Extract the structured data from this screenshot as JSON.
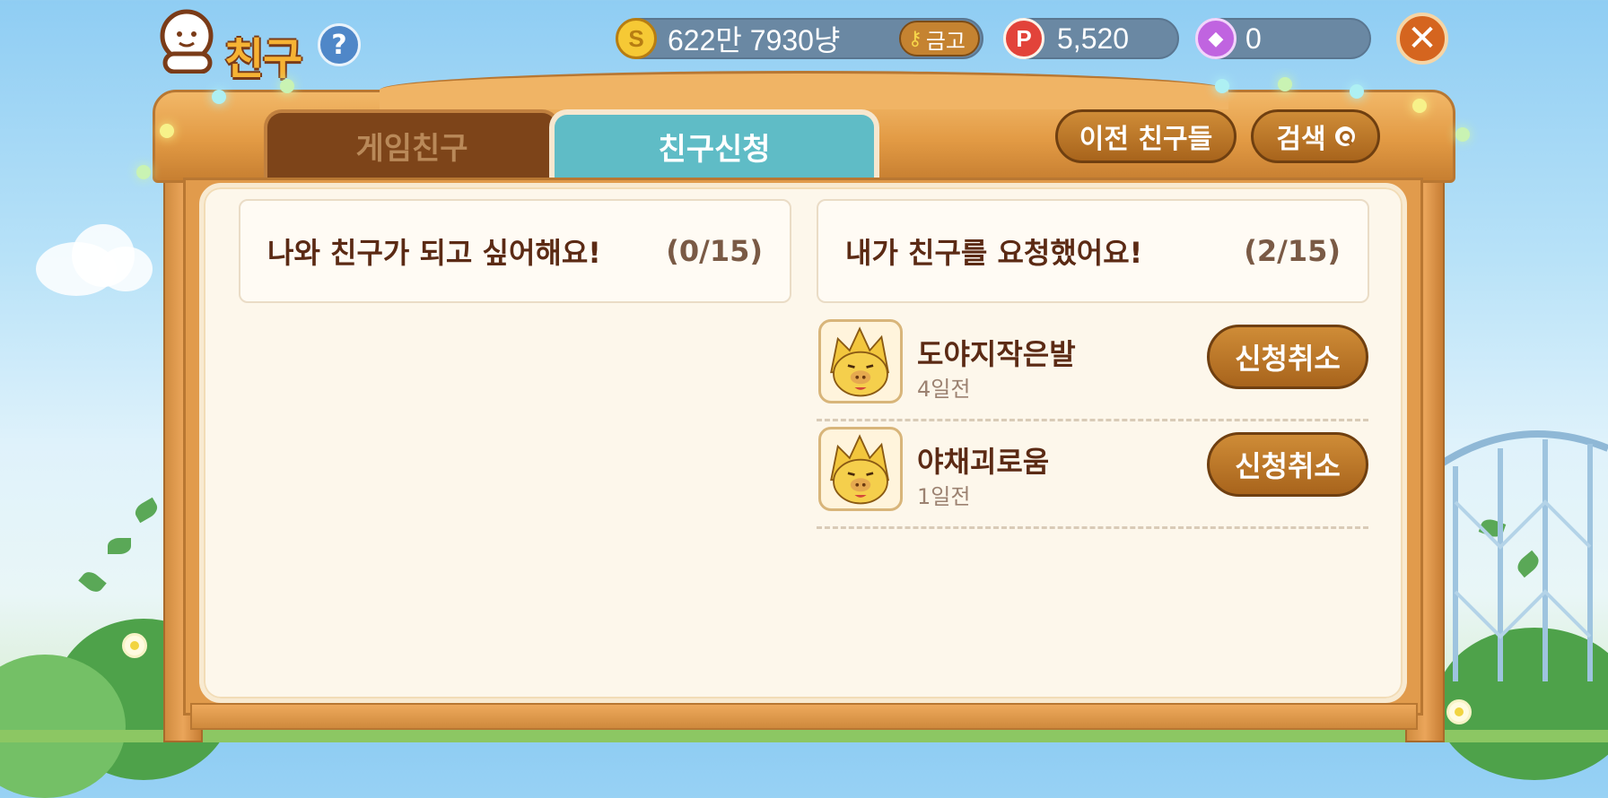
{
  "header": {
    "title": "친구",
    "help_label": "?",
    "close_label": "✕"
  },
  "currency": {
    "gold": "622만 7930냥",
    "vault_label": "금고",
    "points": "5,520",
    "gems": "0"
  },
  "tabs": [
    {
      "label": "게임친구",
      "active": false
    },
    {
      "label": "친구신청",
      "active": true
    }
  ],
  "actions": {
    "previous_friends": "이전 친구들",
    "search": "검색"
  },
  "received": {
    "title": "나와 친구가 되고 싶어해요!",
    "count": "(0/15)"
  },
  "sent": {
    "title": "내가 친구를 요청했어요!",
    "count": "(2/15)",
    "items": [
      {
        "name": "도야지작은발",
        "time": "4일전",
        "action": "신청취소"
      },
      {
        "name": "야채괴로움",
        "time": "1일전",
        "action": "신청취소"
      }
    ]
  },
  "colors": {
    "active_tab": "#5fbcc6",
    "inactive_tab": "#7d4419",
    "wood": "#e29a44",
    "text_brown": "#5b2a14"
  }
}
